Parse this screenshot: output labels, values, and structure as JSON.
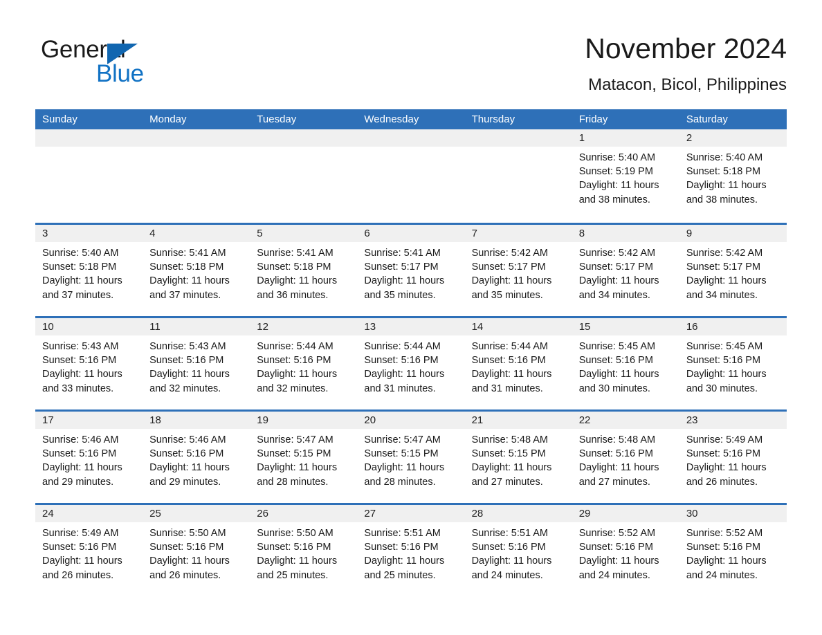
{
  "logo": {
    "word1": "General",
    "word2": "Blue",
    "triangle_icon": "triangle-icon",
    "brand_blue": "#1172c4"
  },
  "header": {
    "month_title": "November 2024",
    "location": "Matacon, Bicol, Philippines",
    "accent_color": "#2e70b8",
    "band_color": "#f0f0f0"
  },
  "weekdays": [
    "Sunday",
    "Monday",
    "Tuesday",
    "Wednesday",
    "Thursday",
    "Friday",
    "Saturday"
  ],
  "weeks": [
    [
      {
        "day": "",
        "lines": []
      },
      {
        "day": "",
        "lines": []
      },
      {
        "day": "",
        "lines": []
      },
      {
        "day": "",
        "lines": []
      },
      {
        "day": "",
        "lines": []
      },
      {
        "day": "1",
        "lines": [
          "Sunrise: 5:40 AM",
          "Sunset: 5:19 PM",
          "Daylight: 11 hours",
          "and 38 minutes."
        ]
      },
      {
        "day": "2",
        "lines": [
          "Sunrise: 5:40 AM",
          "Sunset: 5:18 PM",
          "Daylight: 11 hours",
          "and 38 minutes."
        ]
      }
    ],
    [
      {
        "day": "3",
        "lines": [
          "Sunrise: 5:40 AM",
          "Sunset: 5:18 PM",
          "Daylight: 11 hours",
          "and 37 minutes."
        ]
      },
      {
        "day": "4",
        "lines": [
          "Sunrise: 5:41 AM",
          "Sunset: 5:18 PM",
          "Daylight: 11 hours",
          "and 37 minutes."
        ]
      },
      {
        "day": "5",
        "lines": [
          "Sunrise: 5:41 AM",
          "Sunset: 5:18 PM",
          "Daylight: 11 hours",
          "and 36 minutes."
        ]
      },
      {
        "day": "6",
        "lines": [
          "Sunrise: 5:41 AM",
          "Sunset: 5:17 PM",
          "Daylight: 11 hours",
          "and 35 minutes."
        ]
      },
      {
        "day": "7",
        "lines": [
          "Sunrise: 5:42 AM",
          "Sunset: 5:17 PM",
          "Daylight: 11 hours",
          "and 35 minutes."
        ]
      },
      {
        "day": "8",
        "lines": [
          "Sunrise: 5:42 AM",
          "Sunset: 5:17 PM",
          "Daylight: 11 hours",
          "and 34 minutes."
        ]
      },
      {
        "day": "9",
        "lines": [
          "Sunrise: 5:42 AM",
          "Sunset: 5:17 PM",
          "Daylight: 11 hours",
          "and 34 minutes."
        ]
      }
    ],
    [
      {
        "day": "10",
        "lines": [
          "Sunrise: 5:43 AM",
          "Sunset: 5:16 PM",
          "Daylight: 11 hours",
          "and 33 minutes."
        ]
      },
      {
        "day": "11",
        "lines": [
          "Sunrise: 5:43 AM",
          "Sunset: 5:16 PM",
          "Daylight: 11 hours",
          "and 32 minutes."
        ]
      },
      {
        "day": "12",
        "lines": [
          "Sunrise: 5:44 AM",
          "Sunset: 5:16 PM",
          "Daylight: 11 hours",
          "and 32 minutes."
        ]
      },
      {
        "day": "13",
        "lines": [
          "Sunrise: 5:44 AM",
          "Sunset: 5:16 PM",
          "Daylight: 11 hours",
          "and 31 minutes."
        ]
      },
      {
        "day": "14",
        "lines": [
          "Sunrise: 5:44 AM",
          "Sunset: 5:16 PM",
          "Daylight: 11 hours",
          "and 31 minutes."
        ]
      },
      {
        "day": "15",
        "lines": [
          "Sunrise: 5:45 AM",
          "Sunset: 5:16 PM",
          "Daylight: 11 hours",
          "and 30 minutes."
        ]
      },
      {
        "day": "16",
        "lines": [
          "Sunrise: 5:45 AM",
          "Sunset: 5:16 PM",
          "Daylight: 11 hours",
          "and 30 minutes."
        ]
      }
    ],
    [
      {
        "day": "17",
        "lines": [
          "Sunrise: 5:46 AM",
          "Sunset: 5:16 PM",
          "Daylight: 11 hours",
          "and 29 minutes."
        ]
      },
      {
        "day": "18",
        "lines": [
          "Sunrise: 5:46 AM",
          "Sunset: 5:16 PM",
          "Daylight: 11 hours",
          "and 29 minutes."
        ]
      },
      {
        "day": "19",
        "lines": [
          "Sunrise: 5:47 AM",
          "Sunset: 5:15 PM",
          "Daylight: 11 hours",
          "and 28 minutes."
        ]
      },
      {
        "day": "20",
        "lines": [
          "Sunrise: 5:47 AM",
          "Sunset: 5:15 PM",
          "Daylight: 11 hours",
          "and 28 minutes."
        ]
      },
      {
        "day": "21",
        "lines": [
          "Sunrise: 5:48 AM",
          "Sunset: 5:15 PM",
          "Daylight: 11 hours",
          "and 27 minutes."
        ]
      },
      {
        "day": "22",
        "lines": [
          "Sunrise: 5:48 AM",
          "Sunset: 5:16 PM",
          "Daylight: 11 hours",
          "and 27 minutes."
        ]
      },
      {
        "day": "23",
        "lines": [
          "Sunrise: 5:49 AM",
          "Sunset: 5:16 PM",
          "Daylight: 11 hours",
          "and 26 minutes."
        ]
      }
    ],
    [
      {
        "day": "24",
        "lines": [
          "Sunrise: 5:49 AM",
          "Sunset: 5:16 PM",
          "Daylight: 11 hours",
          "and 26 minutes."
        ]
      },
      {
        "day": "25",
        "lines": [
          "Sunrise: 5:50 AM",
          "Sunset: 5:16 PM",
          "Daylight: 11 hours",
          "and 26 minutes."
        ]
      },
      {
        "day": "26",
        "lines": [
          "Sunrise: 5:50 AM",
          "Sunset: 5:16 PM",
          "Daylight: 11 hours",
          "and 25 minutes."
        ]
      },
      {
        "day": "27",
        "lines": [
          "Sunrise: 5:51 AM",
          "Sunset: 5:16 PM",
          "Daylight: 11 hours",
          "and 25 minutes."
        ]
      },
      {
        "day": "28",
        "lines": [
          "Sunrise: 5:51 AM",
          "Sunset: 5:16 PM",
          "Daylight: 11 hours",
          "and 24 minutes."
        ]
      },
      {
        "day": "29",
        "lines": [
          "Sunrise: 5:52 AM",
          "Sunset: 5:16 PM",
          "Daylight: 11 hours",
          "and 24 minutes."
        ]
      },
      {
        "day": "30",
        "lines": [
          "Sunrise: 5:52 AM",
          "Sunset: 5:16 PM",
          "Daylight: 11 hours",
          "and 24 minutes."
        ]
      }
    ]
  ]
}
